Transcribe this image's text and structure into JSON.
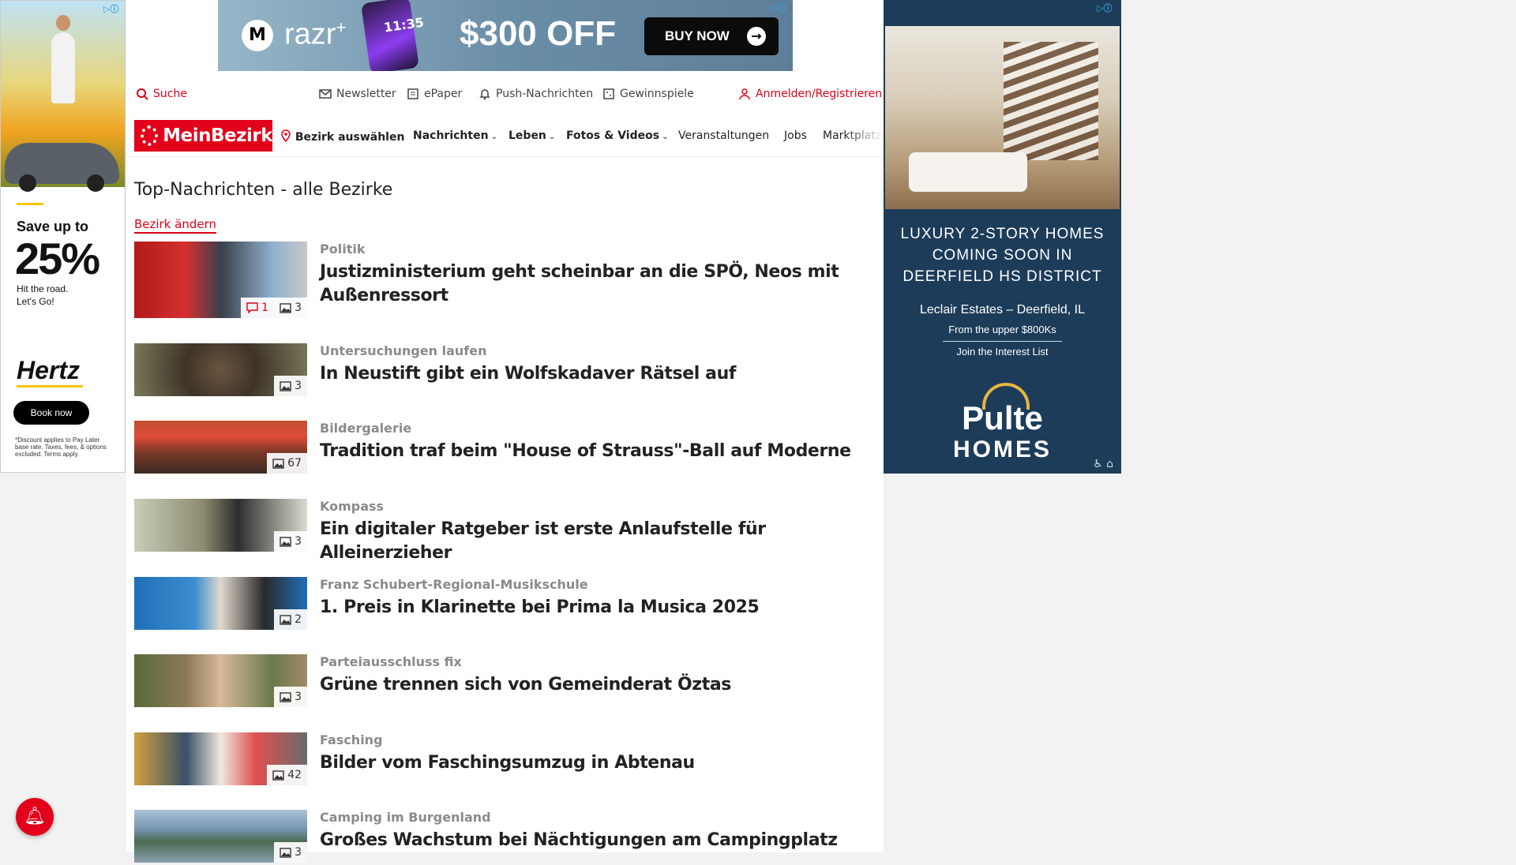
{
  "ad_left": {
    "headline": "Save up to",
    "big": "25%",
    "line1": "Hit the road.",
    "line2": "Let's Go!",
    "brand": "Hertz",
    "cta": "Book now",
    "fine_print": "*Discount applies to Pay Later base rate. Taxes, fees, & options excluded. Terms apply."
  },
  "ad_top": {
    "brand": "razr",
    "brand_sup": "+",
    "phone_time": "11:35",
    "offer": "$300 OFF",
    "cta": "BUY NOW"
  },
  "utility": {
    "search": "Suche",
    "newsletter": "Newsletter",
    "epaper": "ePaper",
    "push": "Push-Nachrichten",
    "contests": "Gewinnspiele",
    "login": "Anmelden/Registrieren"
  },
  "nav": {
    "logo": "MeinBezirk",
    "district": "Bezirk auswählen",
    "items": [
      "Nachrichten",
      "Leben",
      "Fotos & Videos",
      "Veranstaltungen",
      "Jobs",
      "Marktplatz"
    ]
  },
  "content": {
    "title": "Top-Nachrichten - alle Bezirke",
    "change_district": "Bezirk ändern",
    "articles": [
      {
        "kicker": "Politik",
        "headline": "Justizministerium geht scheinbar an die SPÖ, Neos mit Außenressort",
        "comments": "1",
        "images": "3"
      },
      {
        "kicker": "Untersuchungen laufen",
        "headline": "In Neustift gibt ein Wolfskadaver Rätsel auf",
        "images": "3"
      },
      {
        "kicker": "Bildergalerie",
        "headline": "Tradition traf beim \"House of Strauss\"-Ball auf Moderne",
        "images": "67"
      },
      {
        "kicker": "Kompass",
        "headline": "Ein digitaler Ratgeber ist erste Anlaufstelle für Alleinerzieher",
        "images": "3"
      },
      {
        "kicker": "Franz Schubert-Regional-Musikschule",
        "headline": "1. Preis in Klarinette bei Prima la Musica 2025",
        "images": "2"
      },
      {
        "kicker": "Parteiausschluss fix",
        "headline": "Grüne trennen sich von Gemeinderat Öztas",
        "images": "3"
      },
      {
        "kicker": "Fasching",
        "headline": "Bilder vom Faschingsumzug in Abtenau",
        "images": "42"
      },
      {
        "kicker": "Camping im Burgenland",
        "headline": "Großes Wachstum bei Nächtigungen am Campingplatz",
        "images": "3"
      }
    ]
  },
  "ad_right": {
    "line1": "LUXURY 2-STORY HOMES",
    "line2": "COMING SOON IN",
    "line3": "DEERFIELD HS DISTRICT",
    "location": "Leclair Estates – Deerfield, IL",
    "price": "From the upper $800Ks",
    "cta": "Join the Interest List",
    "brand1": "Pulte",
    "brand2": "HOMES"
  },
  "icons": {
    "search": "search-icon",
    "mail": "mail-icon",
    "newspaper": "newspaper-icon",
    "bell": "bell-icon",
    "gift": "gift-icon",
    "user": "user-icon",
    "pin": "location-pin-icon",
    "comment": "comment-icon",
    "image": "image-icon"
  },
  "colors": {
    "brand_red": "#e2001a",
    "kicker_gray": "#8a8a8a",
    "ad_navy": "#1d3c5a"
  }
}
